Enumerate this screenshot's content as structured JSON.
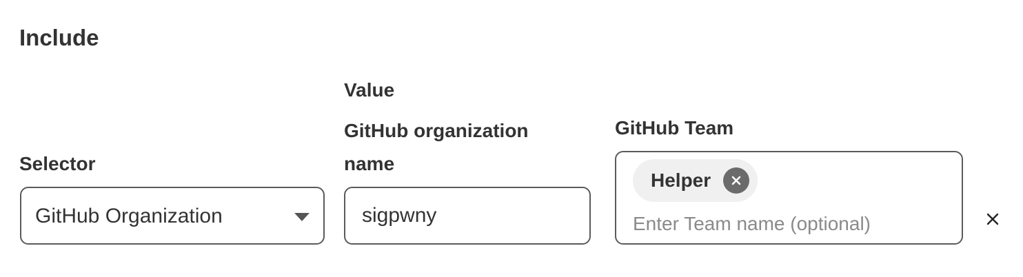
{
  "section": {
    "heading": "Include"
  },
  "selector": {
    "label": "Selector",
    "value": "GitHub Organization",
    "icon": "chevron-down-icon"
  },
  "value_field": {
    "group_label": "Value",
    "label_line1": "GitHub organization",
    "label_line2": "name",
    "value": "sigpwny"
  },
  "team_field": {
    "label": "GitHub Team",
    "chips": [
      {
        "label": "Helper",
        "remove_icon": "close-icon"
      }
    ],
    "placeholder": "Enter Team name (optional)"
  },
  "row": {
    "remove_icon": "close-icon"
  },
  "colors": {
    "text": "#333333",
    "border": "#5a5a5a",
    "chip_bg": "#f0f0f0",
    "chip_remove_bg": "#6b6b6b",
    "placeholder": "#8a8a8a"
  }
}
